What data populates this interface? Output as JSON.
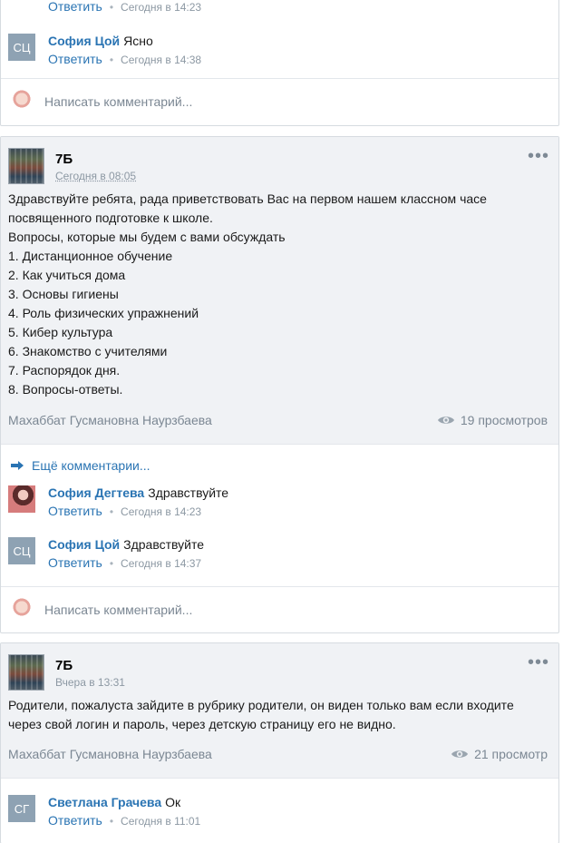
{
  "comment_field_placeholder": "Написать комментарий...",
  "reply_label": "Ответить",
  "more_comments_label": "Ещё комментарии...",
  "top_card": {
    "partial_comment": {
      "reply": "Ответить",
      "time": "Сегодня в 14:23"
    },
    "comment": {
      "initials": "СЦ",
      "author": "София Цой",
      "text": "Ясно",
      "time": "Сегодня в 14:38"
    }
  },
  "posts": [
    {
      "group": "7Б",
      "date": "Сегодня в 08:05",
      "text_lines": [
        "Здравствуйте ребята, рада приветствовать Вас на первом нашем классном часе",
        "посвященного подготовке к школе.",
        "Вопросы, которые мы будем с вами обсуждать",
        "1. Дистанционное обучение",
        "2. Как учиться дома",
        "3. Основы гигиены",
        "4. Роль физических упражнений",
        "5. Кибер культура",
        "6. Знакомство с учителями",
        "7. Распорядок дня.",
        "8. Вопросы-ответы."
      ],
      "author": "Махаббат Гусмановна Наурзбаева",
      "views": "19 просмотров",
      "comments": [
        {
          "author": "София Дегтева",
          "text": "Здравствуйте",
          "time": "Сегодня в 14:23"
        },
        {
          "initials": "СЦ",
          "author": "София Цой",
          "text": "Здравствуйте",
          "time": "Сегодня в 14:37"
        }
      ]
    },
    {
      "group": "7Б",
      "date": "Вчера в 13:31",
      "text_lines": [
        "Родители, пожалуста зайдите в рубрику родители, он виден только вам если входите",
        "через свой логин и пароль, через детскую страницу его не видно."
      ],
      "author": "Махаббат Гусмановна Наурзбаева",
      "views": "21 просмотр",
      "comments": [
        {
          "initials": "СГ",
          "author": "Светлана Грачева",
          "text": "Ок",
          "time": "Сегодня в 11:01"
        }
      ]
    }
  ]
}
